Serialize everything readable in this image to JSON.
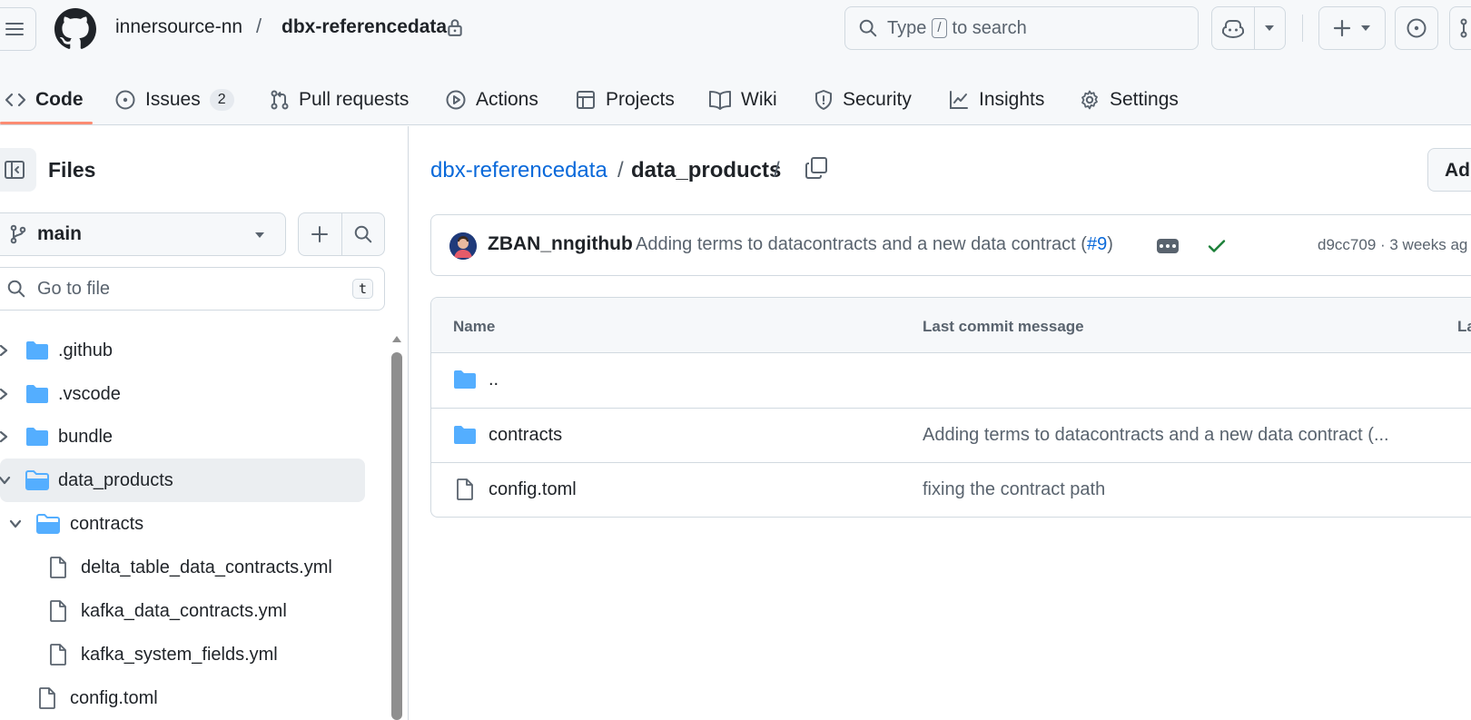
{
  "header": {
    "owner": "innersource-nn",
    "separator": "/",
    "repo": "dbx-referencedata",
    "search": {
      "prefix": "Type",
      "key": "/",
      "suffix": "to search"
    }
  },
  "repo_nav": [
    {
      "label": "Code",
      "icon": "code-icon",
      "active": true
    },
    {
      "label": "Issues",
      "icon": "issue-opened-icon",
      "count": "2"
    },
    {
      "label": "Pull requests",
      "icon": "git-pull-request-icon"
    },
    {
      "label": "Actions",
      "icon": "play-icon"
    },
    {
      "label": "Projects",
      "icon": "table-icon"
    },
    {
      "label": "Wiki",
      "icon": "book-icon"
    },
    {
      "label": "Security",
      "icon": "shield-icon"
    },
    {
      "label": "Insights",
      "icon": "graph-icon"
    },
    {
      "label": "Settings",
      "icon": "gear-icon"
    }
  ],
  "sidebar": {
    "title": "Files",
    "branch": "main",
    "goto_placeholder": "Go to file",
    "goto_key": "t",
    "tree": [
      {
        "label": ".github",
        "type": "folder",
        "expanded": false
      },
      {
        "label": ".vscode",
        "type": "folder",
        "expanded": false
      },
      {
        "label": "bundle",
        "type": "folder",
        "expanded": false
      },
      {
        "label": "data_products",
        "type": "folder",
        "expanded": true,
        "selected": true
      },
      {
        "label": "contracts",
        "type": "folder",
        "expanded": true
      },
      {
        "label": "delta_table_data_contracts.yml",
        "type": "file"
      },
      {
        "label": "kafka_data_contracts.yml",
        "type": "file"
      },
      {
        "label": "kafka_system_fields.yml",
        "type": "file"
      },
      {
        "label": "config.toml",
        "type": "file"
      }
    ]
  },
  "main": {
    "path_repo": "dbx-referencedata",
    "path_sep": "/",
    "path_dir": "data_products",
    "add_file_label": "Ad",
    "commit": {
      "author": "ZBAN_nngithub",
      "message": "Adding terms to datacontracts and a new data contract (",
      "pr": "#9",
      "message_end": ")",
      "meta": "d9cc709 · 3 weeks ag"
    },
    "table": {
      "headers": [
        "Name",
        "Last commit message",
        "La"
      ],
      "rows": [
        {
          "name": "..",
          "type": "folder",
          "message": ""
        },
        {
          "name": "contracts",
          "type": "folder",
          "message": "Adding terms to datacontracts and a new data contract (..."
        },
        {
          "name": "config.toml",
          "type": "file",
          "message": "fixing the contract path"
        }
      ]
    }
  },
  "colors": {
    "accent": "#0969da",
    "folder": "#54aeff",
    "success": "#1a7f37",
    "nav_underline": "#fd8c73"
  }
}
